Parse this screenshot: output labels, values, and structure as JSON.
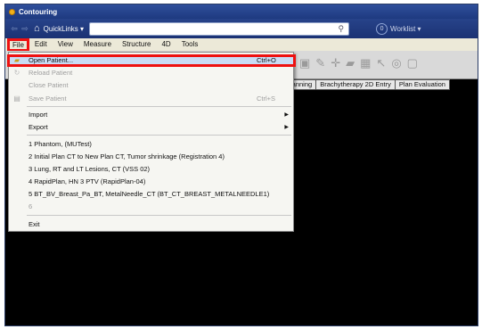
{
  "window": {
    "title": "Contouring"
  },
  "quickbar": {
    "back_arrow": "⇦",
    "forward_arrow": "⇨",
    "quicklinks_label": "QuickLinks ▾",
    "search_value": "",
    "worklist_count": "0",
    "worklist_label": "Worklist ▾"
  },
  "menubar": {
    "items": [
      "File",
      "Edit",
      "View",
      "Measure",
      "Structure",
      "4D",
      "Tools"
    ]
  },
  "tabs": [
    "Planning",
    "Brachytherapy 2D Entry",
    "Plan Evaluation"
  ],
  "file_menu": {
    "open_patient": {
      "label": "Open Patient...",
      "shortcut": "Ctrl+O"
    },
    "reload_patient": {
      "label": "Reload Patient"
    },
    "close_patient": {
      "label": "Close Patient"
    },
    "save_patient": {
      "label": "Save Patient",
      "shortcut": "Ctrl+S"
    },
    "import": {
      "label": "Import"
    },
    "export": {
      "label": "Export"
    },
    "recent": [
      "1 Phantom, (MUTest)",
      "2 Initial Plan CT to New Plan CT, Tumor shrinkage (Registration 4)",
      "3 Lung, RT and LT Lesions, CT (VSS 02)",
      "4 RapidPlan, HN 3 PTV (RapidPlan-04)",
      "5 BT_BV_Breast_Pa_BT, MetalNeedle_CT (BT_CT_BREAST_METALNEEDLE1)",
      "6"
    ],
    "exit": {
      "label": "Exit"
    }
  },
  "colors": {
    "highlight_box": "#ee1111",
    "title_bar": "#1e3a80",
    "menu_bg": "#ece9d8"
  }
}
